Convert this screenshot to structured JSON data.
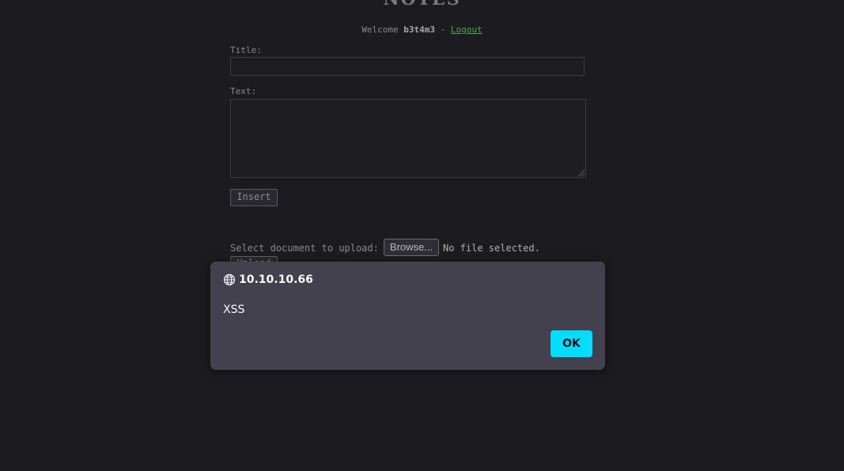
{
  "page": {
    "title": "NOTES",
    "welcome_prefix": "Welcome ",
    "username": "b3t4m3",
    "separator": " - ",
    "logout_label": "Logout"
  },
  "note_form": {
    "title_label": "Title:",
    "title_value": "",
    "text_label": "Text:",
    "text_value": "",
    "insert_label": "Insert"
  },
  "upload_form": {
    "label": "Select document to upload:",
    "browse_label": "Browse...",
    "file_status": "No file selected.",
    "upload_label": "Upload"
  },
  "alert_dialog": {
    "origin": "10.10.10.66",
    "origin_icon": "globe-icon",
    "message": "XSS",
    "ok_label": "OK",
    "accent_color": "#00ddff",
    "background_color": "#42414d"
  }
}
